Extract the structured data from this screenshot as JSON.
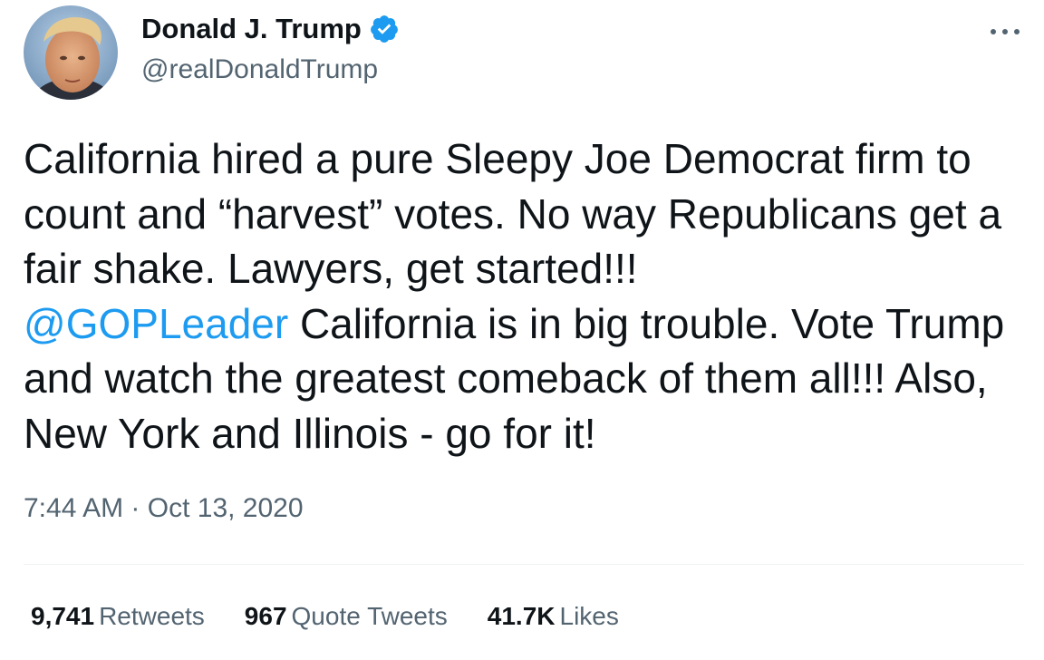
{
  "author": {
    "display_name": "Donald J. Trump",
    "handle": "@realDonaldTrump",
    "verified": true
  },
  "tweet": {
    "text_before_mention": "California hired a pure Sleepy Joe Democrat firm to count and “harvest” votes. No way Republicans get a fair shake. Lawyers, get started!!! ",
    "mention": "@GOPLeader",
    "text_after_mention": "  California is in big trouble. Vote Trump and watch the greatest comeback of them all!!! Also, New York and Illinois - go for it!",
    "time": "7:44 AM",
    "separator": " · ",
    "date": "Oct 13, 2020"
  },
  "stats": {
    "retweets_count": "9,741",
    "retweets_label": "Retweets",
    "quotes_count": "967",
    "quotes_label": "Quote Tweets",
    "likes_count": "41.7K",
    "likes_label": "Likes"
  },
  "icons": {
    "verified": "verified-badge-icon",
    "more": "more-options-icon"
  },
  "colors": {
    "link": "#1d9bf0",
    "text": "#0f1419",
    "muted": "#536471",
    "divider": "#eff3f4"
  }
}
